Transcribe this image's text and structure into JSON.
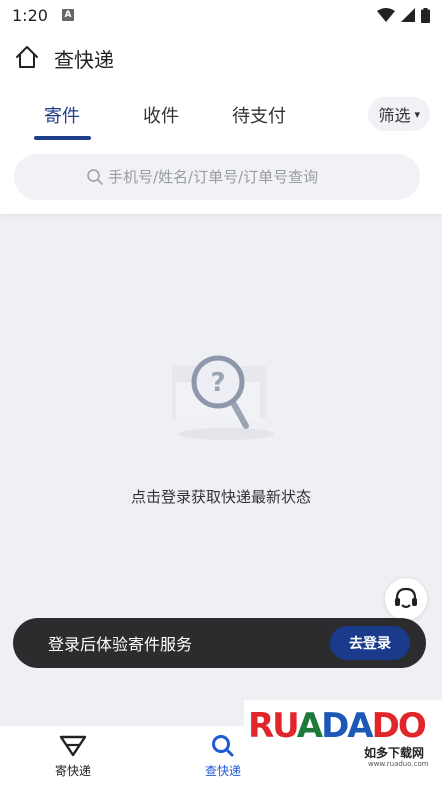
{
  "status_bar": {
    "time": "1:20",
    "notif_letter": "A"
  },
  "header": {
    "title": "查快递"
  },
  "tabs": [
    {
      "label": "寄件",
      "active": true
    },
    {
      "label": "收件",
      "active": false
    },
    {
      "label": "待支付",
      "active": false
    }
  ],
  "filter": {
    "label": "筛选",
    "arrow": "▾"
  },
  "search": {
    "placeholder": "手机号/姓名/订单号/订单号查询"
  },
  "empty": {
    "message": "点击登录获取快递最新状态"
  },
  "login_banner": {
    "text": "登录后体验寄件服务",
    "button_label": "去登录"
  },
  "bottom_nav": [
    {
      "label": "寄快递",
      "icon": "send-triangle-icon",
      "active": false
    },
    {
      "label": "查快递",
      "icon": "search-icon",
      "active": true
    }
  ],
  "watermark": {
    "letters": "RUADADO",
    "subtitle": "如多下载网",
    "url": "www.ruaduo.com"
  },
  "colors": {
    "accent": "#1f3f8a",
    "nav_active": "#1f5ad6",
    "banner_bg": "#2c2c2e",
    "page_bg": "#eef0f4"
  }
}
